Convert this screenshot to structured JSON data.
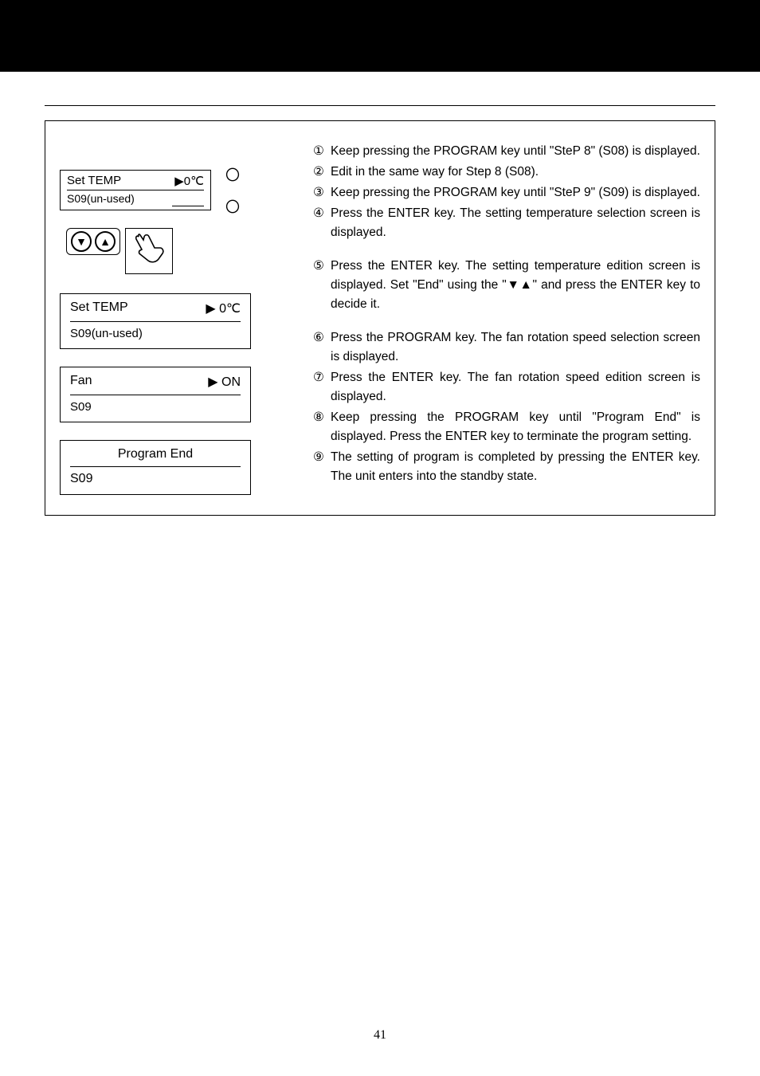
{
  "lcd_small": {
    "label": "Set TEMP",
    "value": "▶0℃",
    "sub": "S09(un-used)"
  },
  "led_glyph": "〇",
  "keypad": {
    "down": "▼",
    "up": "▲"
  },
  "lcd_set_temp": {
    "label": "Set TEMP",
    "value": "▶ 0℃",
    "sub": "S09(un-used)"
  },
  "lcd_fan": {
    "label": "Fan",
    "value": "▶ ON",
    "sub": "S09"
  },
  "lcd_program_end": {
    "label": "Program End",
    "sub": "S09"
  },
  "steps": {
    "s1": "Keep pressing the PROGRAM key until \"SteP 8\" (S08) is displayed.",
    "s2": "Edit in the same way for Step 8 (S08).",
    "s3": "Keep pressing the PROGRAM key until \"SteP 9\" (S09) is displayed.",
    "s4": "Press the ENTER key.   The setting temperature selection screen is displayed.",
    "s5": "Press the ENTER key.  The setting temperature edition screen is displayed.  Set \"End\" using the \"▼▲\" and press the ENTER key to decide it.",
    "s6": "Press the PROGRAM key.   The fan rotation speed selection screen is displayed.",
    "s7": "Press the ENTER key.  The fan rotation speed edition screen is displayed.",
    "s8": "Keep pressing the PROGRAM key until \"Program End\" is displayed.  Press the ENTER key to terminate the program setting.",
    "s9": "The setting of program is completed by pressing the ENTER key.   The unit enters into the standby state."
  },
  "nums": {
    "n1": "①",
    "n2": "②",
    "n3": "③",
    "n4": "④",
    "n5": "⑤",
    "n6": "⑥",
    "n7": "⑦",
    "n8": "⑧",
    "n9": "⑨"
  },
  "page_number": "41"
}
